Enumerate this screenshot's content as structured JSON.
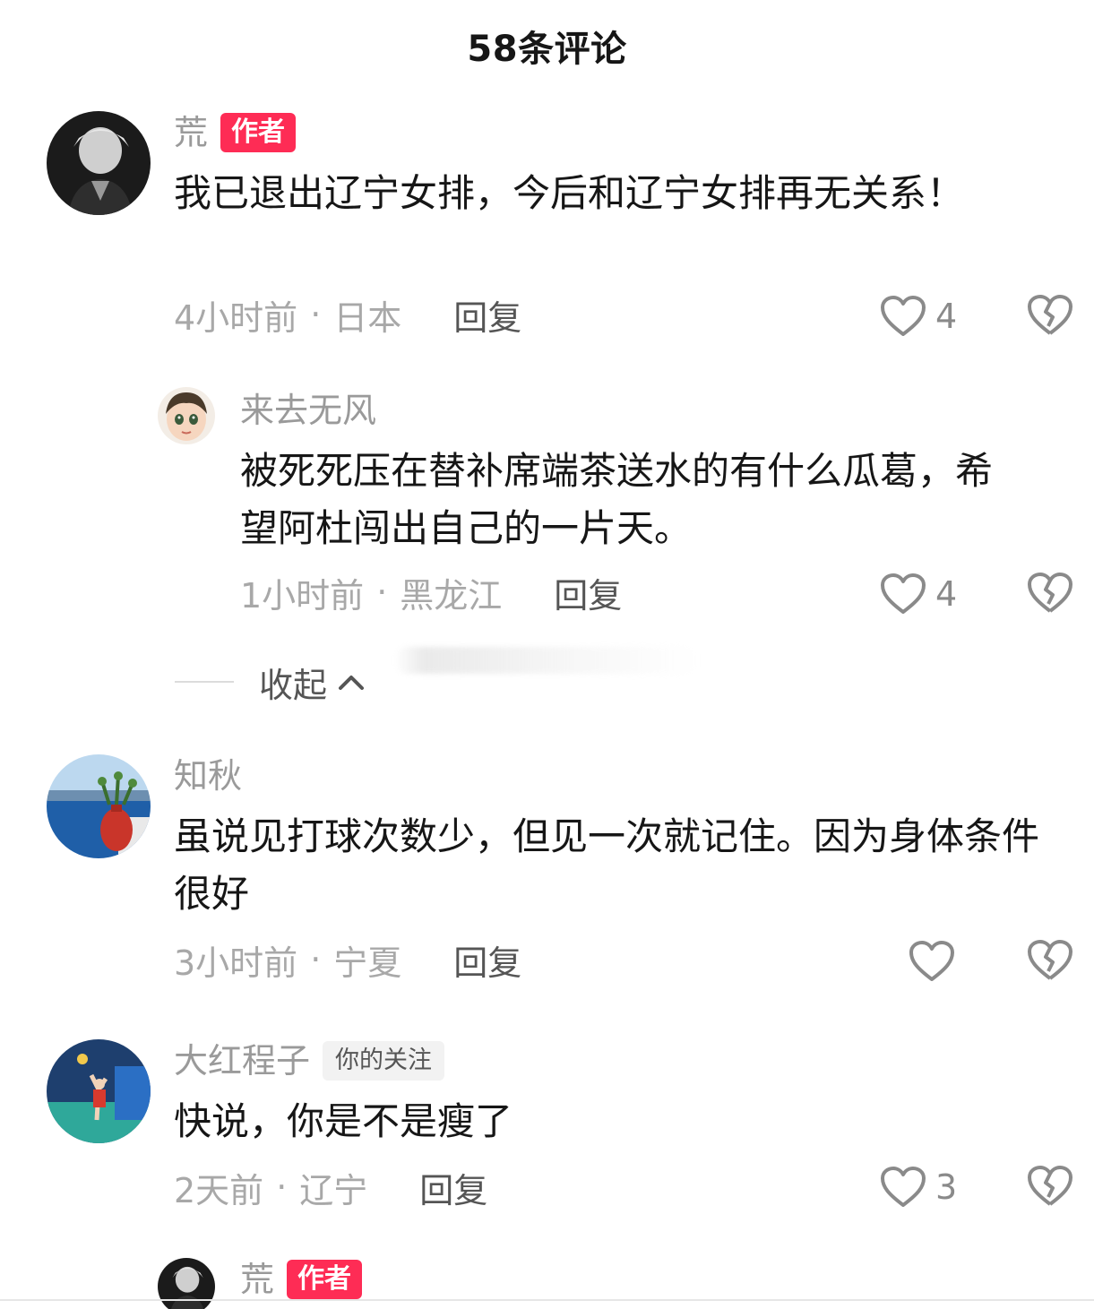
{
  "header": {
    "title": "58条评论"
  },
  "comments": [
    {
      "username": "荒",
      "badge": "作者",
      "text": "我已退出辽宁女排，今后和辽宁女排再无关系！",
      "time": "4小时前",
      "location": "日本",
      "reply_label": "回复",
      "like_count": "4",
      "avatar_icon": "dark-anime-avatar-icon"
    },
    {
      "username": "来去无风",
      "text": "被死死压在替补席端茶送水的有什么瓜葛，希望阿杜闯出自己的一片天。",
      "time": "1小时前",
      "location": "黑龙江",
      "reply_label": "回复",
      "like_count": "4",
      "avatar_icon": "cartoon-face-avatar-icon"
    },
    {
      "username": "知秋",
      "text": "虽说见打球次数少，但见一次就记住。因为身体条件很好",
      "time": "3小时前",
      "location": "宁夏",
      "reply_label": "回复",
      "like_count": "",
      "avatar_icon": "seaside-vase-avatar-icon"
    },
    {
      "username": "大红程子",
      "badge": "你的关注",
      "text": "快说，你是不是瘦了",
      "time": "2天前",
      "location": "辽宁",
      "reply_label": "回复",
      "like_count": "3",
      "avatar_icon": "volleyball-player-avatar-icon"
    },
    {
      "username": "荒",
      "badge": "作者",
      "avatar_icon": "dark-anime-avatar-icon"
    }
  ],
  "collapse": {
    "label": "收起",
    "icon": "chevron-up-icon"
  },
  "separator": "·",
  "icons": {
    "like": "heart-outline-icon",
    "dislike": "broken-heart-icon"
  },
  "colors": {
    "author_badge": "#fe2c55",
    "muted_text": "#a8a8a8",
    "main_text": "#161616"
  }
}
